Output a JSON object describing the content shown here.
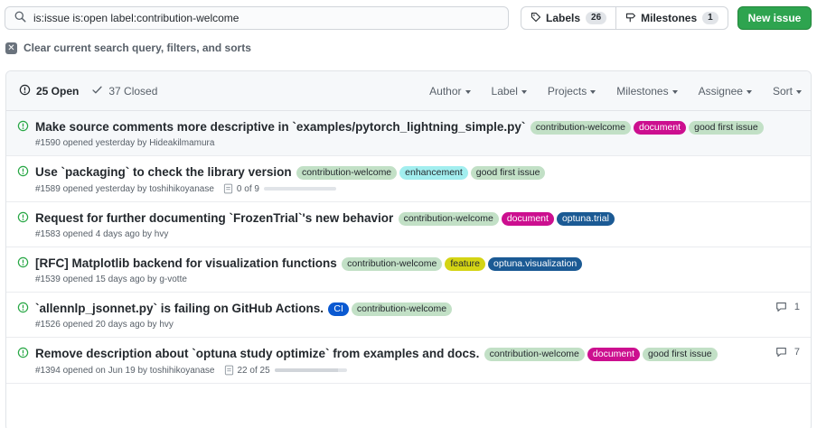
{
  "search": {
    "value": "is:issue is:open label:contribution-welcome"
  },
  "labels_button": {
    "label": "Labels",
    "count": "26"
  },
  "milestones_button": {
    "label": "Milestones",
    "count": "1"
  },
  "new_issue_label": "New issue",
  "clear_text": "Clear current search query, filters, and sorts",
  "header": {
    "open_label": "25 Open",
    "closed_label": "37 Closed",
    "filters": [
      "Author",
      "Label",
      "Projects",
      "Milestones",
      "Assignee",
      "Sort"
    ]
  },
  "colors": {
    "contribution-welcome": {
      "bg": "#c2e0c6",
      "fg": "#24292e"
    },
    "document": {
      "bg": "#cc0f8f",
      "fg": "#ffffff"
    },
    "good first issue": {
      "bg": "#c2e0c6",
      "fg": "#24292e"
    },
    "enhancement": {
      "bg": "#a2eeef",
      "fg": "#24292e"
    },
    "optuna.trial": {
      "bg": "#1b5a94",
      "fg": "#ffffff"
    },
    "feature": {
      "bg": "#d4d414",
      "fg": "#24292e"
    },
    "optuna.visualization": {
      "bg": "#1b5a94",
      "fg": "#ffffff"
    },
    "CI": {
      "bg": "#0a59d1",
      "fg": "#ffffff"
    }
  },
  "issues": [
    {
      "title": "Make source comments more descriptive in `examples/pytorch_lightning_simple.py`",
      "labels": [
        "contribution-welcome",
        "document",
        "good first issue"
      ],
      "meta": "#1590 opened yesterday by Hideakilmamura",
      "highlight": true
    },
    {
      "title": "Use `packaging` to check the library version",
      "labels": [
        "contribution-welcome",
        "enhancement",
        "good first issue"
      ],
      "meta": "#1589 opened yesterday by toshihikoyanase",
      "progress": {
        "text": "0 of 9",
        "fraction": 0
      }
    },
    {
      "title": "Request for further documenting `FrozenTrial`'s new behavior",
      "labels": [
        "contribution-welcome",
        "document",
        "optuna.trial"
      ],
      "meta": "#1583 opened 4 days ago by hvy"
    },
    {
      "title": "[RFC] Matplotlib backend for visualization functions",
      "labels": [
        "contribution-welcome",
        "feature",
        "optuna.visualization"
      ],
      "meta": "#1539 opened 15 days ago by g-votte"
    },
    {
      "title": "`allennlp_jsonnet.py` is failing on GitHub Actions.",
      "labels": [
        "CI",
        "contribution-welcome"
      ],
      "meta": "#1526 opened 20 days ago by hvy",
      "comments": "1"
    },
    {
      "title": "Remove description about `optuna study optimize` from examples and docs.",
      "labels": [
        "contribution-welcome",
        "document",
        "good first issue"
      ],
      "meta": "#1394 opened on Jun 19 by toshihikoyanase",
      "progress": {
        "text": "22 of 25",
        "fraction": 0.88
      },
      "comments": "7"
    }
  ]
}
